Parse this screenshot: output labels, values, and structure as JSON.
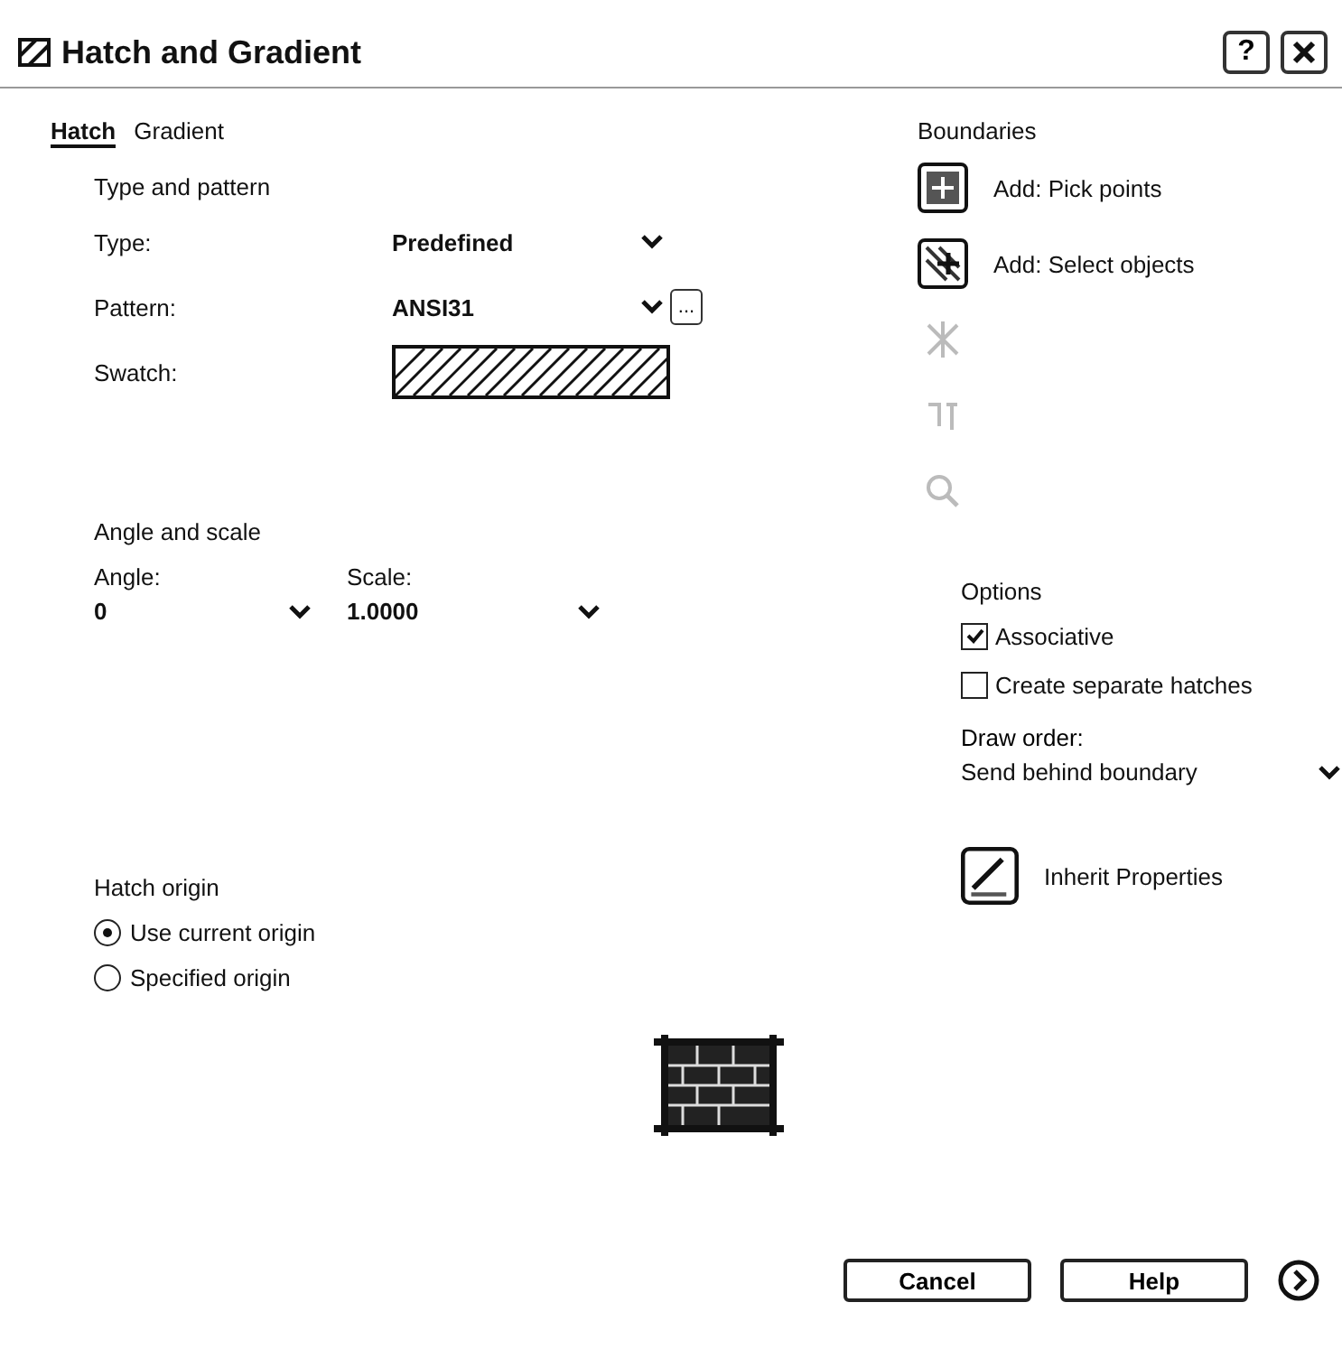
{
  "window": {
    "title": "Hatch and Gradient",
    "help_button": "?"
  },
  "tabs": [
    {
      "label": "Hatch",
      "selected": true
    },
    {
      "label": "Gradient",
      "selected": false
    }
  ],
  "type_and_pattern": {
    "heading": "Type and pattern",
    "fields": [
      {
        "label": "Type:",
        "value": "Predefined",
        "kind": "dropdown"
      },
      {
        "label": "Pattern:",
        "value": "ANSI31",
        "kind": "dropdown-browse",
        "browse": "..."
      },
      {
        "label": "Swatch:",
        "kind": "swatch"
      }
    ]
  },
  "angle_and_scale": {
    "heading": "Angle and scale",
    "fields": [
      {
        "label": "Angle:",
        "value": "0"
      },
      {
        "label": "Scale:",
        "value": "1.0000"
      }
    ]
  },
  "hatch_origin": {
    "heading": "Hatch origin",
    "options": [
      {
        "label": "Use current origin",
        "selected": true
      },
      {
        "label": "Specified origin",
        "selected": false
      }
    ]
  },
  "boundaries": {
    "heading": "Boundaries",
    "buttons": [
      {
        "label": "Add: Pick points",
        "kind": "pick"
      },
      {
        "label": "Add: Select objects",
        "kind": "select"
      }
    ],
    "disabled_tools": [
      {
        "kind": "remove"
      },
      {
        "kind": "recreate"
      },
      {
        "kind": "view"
      }
    ]
  },
  "options": {
    "heading": "Options",
    "checkboxes": [
      {
        "label": "Associative",
        "checked": true
      },
      {
        "label": "Create separate hatches",
        "checked": false
      }
    ],
    "draw_order": {
      "label": "Draw order:",
      "value": "Send behind boundary"
    },
    "inherit": "Inherit Properties"
  },
  "footer_buttons": [
    "Cancel",
    "Help"
  ]
}
